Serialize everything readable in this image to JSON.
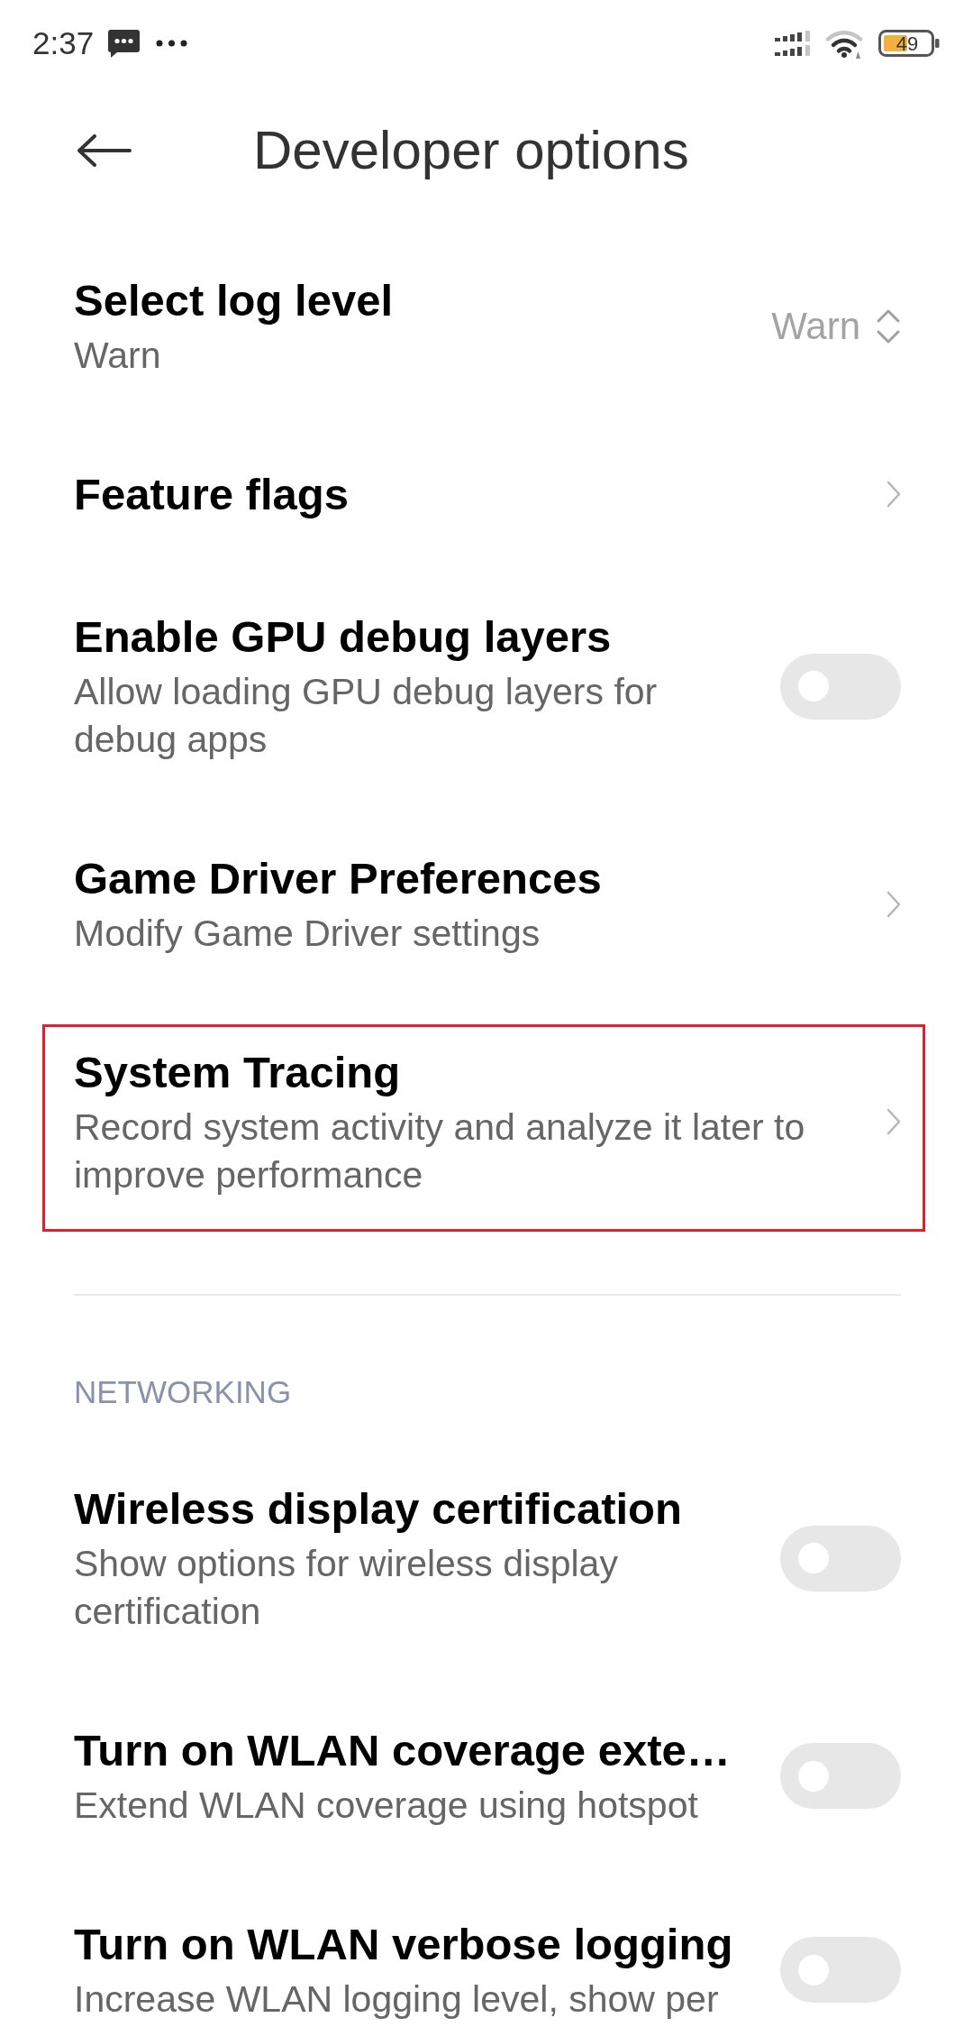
{
  "status_bar": {
    "time": "2:37",
    "battery": "49"
  },
  "toolbar": {
    "title": "Developer options"
  },
  "sections": [
    {
      "items": [
        {
          "kind": "select",
          "title": "Select log level",
          "subtitle": "Warn",
          "value": "Warn",
          "highlighted": false
        },
        {
          "kind": "link",
          "title": "Feature flags",
          "highlighted": false
        },
        {
          "kind": "switch",
          "title": "Enable GPU debug layers",
          "subtitle": "Allow loading GPU debug layers for debug apps",
          "on": false,
          "highlighted": false
        },
        {
          "kind": "link",
          "title": "Game Driver Preferences",
          "subtitle": "Modify Game Driver settings",
          "highlighted": false
        },
        {
          "kind": "link",
          "title": "System Tracing",
          "subtitle": "Record system activity and analyze it later to improve performance",
          "highlighted": true
        }
      ]
    },
    {
      "header": "NETWORKING",
      "items": [
        {
          "kind": "switch",
          "title": "Wireless display certification",
          "subtitle": "Show options for wireless display certification",
          "on": false,
          "highlighted": false
        },
        {
          "kind": "switch",
          "title": "Turn on WLAN coverage exte…",
          "subtitle": "Extend WLAN coverage using hotspot",
          "on": false,
          "highlighted": false
        },
        {
          "kind": "switch",
          "title": "Turn on WLAN verbose logging",
          "subtitle": "Increase WLAN logging level, show per",
          "on": false,
          "highlighted": false
        }
      ]
    }
  ]
}
